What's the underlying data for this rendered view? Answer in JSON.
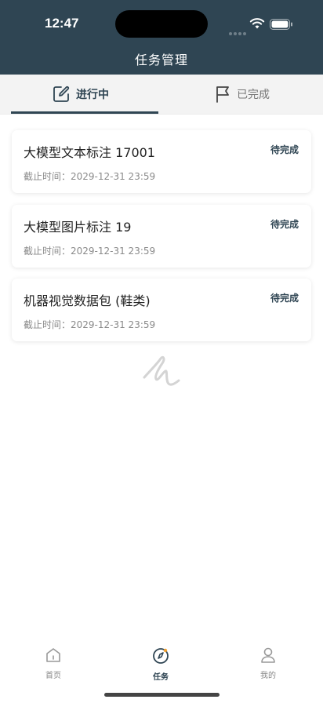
{
  "status_bar": {
    "time": "12:47"
  },
  "header": {
    "title": "任务管理"
  },
  "tabs": [
    {
      "label": "进行中",
      "icon": "edit-icon",
      "active": true
    },
    {
      "label": "已完成",
      "icon": "flag-icon",
      "active": false
    }
  ],
  "tasks": [
    {
      "title": "大模型文本标注 17001",
      "status": "待完成",
      "deadline": "截止时间：2029-12-31 23:59"
    },
    {
      "title": "大模型图片标注 19",
      "status": "待完成",
      "deadline": "截止时间：2029-12-31 23:59"
    },
    {
      "title": "机器视觉数据包 (鞋类)",
      "status": "待完成",
      "deadline": "截止时间：2029-12-31 23:59"
    }
  ],
  "bottom_nav": [
    {
      "label": "首页",
      "icon": "home-icon"
    },
    {
      "label": "任务",
      "icon": "compass-icon",
      "active": true
    },
    {
      "label": "我的",
      "icon": "user-icon"
    }
  ],
  "colors": {
    "primary": "#2f4553",
    "accent": "#f0a030"
  }
}
